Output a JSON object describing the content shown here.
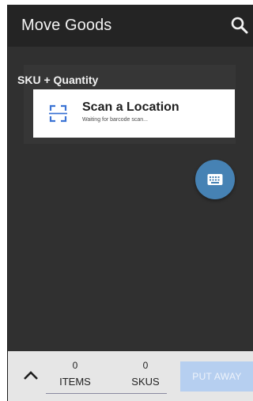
{
  "app_bar": {
    "title": "Move Goods",
    "search_icon": "search-icon"
  },
  "section": {
    "label": "SKU + Quantity"
  },
  "scan_card": {
    "icon": "barcode-scan-icon",
    "title": "Scan a Location",
    "subtitle": "Waiting for barcode scan..."
  },
  "fab": {
    "icon": "keyboard-icon",
    "color": "#4682b4"
  },
  "bottom_bar": {
    "expand_icon": "chevron-up-icon",
    "items_count": "0",
    "items_label": "ITEMS",
    "skus_count": "0",
    "skus_label": "SKUS",
    "put_away_label": "PUT AWAY"
  },
  "colors": {
    "app_bar": "#242424",
    "background": "#303030",
    "card": "#ffffff",
    "scan_accent": "#3b73d4",
    "put_away_disabled": "#b6cff0"
  }
}
